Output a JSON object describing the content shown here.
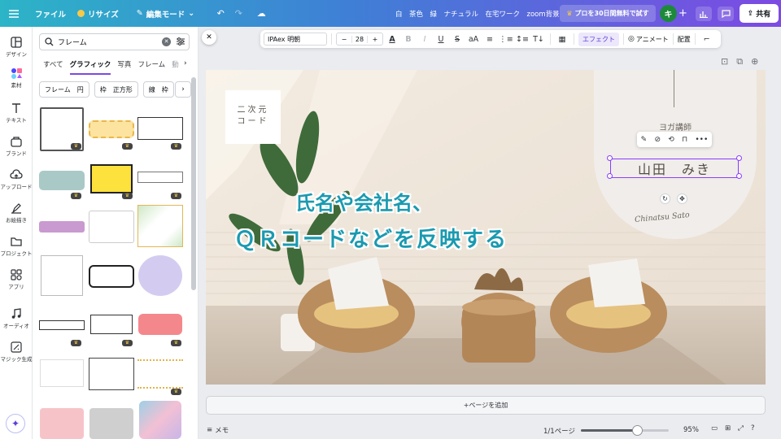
{
  "topbar": {
    "menu_icon": "hamburger-icon",
    "file": "ファイル",
    "resize": "リサイズ",
    "edit_mode": "編集モード",
    "doc_title": "白　茶色　緑　ナチュラル　在宅ワーク　zoom背景",
    "pro_trial": "プロを30日間無料で試す",
    "avatar_initial": "キ",
    "share": "共有"
  },
  "rail": {
    "items": [
      {
        "label": "デザイン",
        "icon": "layout-icon"
      },
      {
        "label": "素材",
        "icon": "elements-icon"
      },
      {
        "label": "テキスト",
        "icon": "text-icon"
      },
      {
        "label": "ブランド",
        "icon": "brand-icon"
      },
      {
        "label": "アップロード",
        "icon": "upload-cloud-icon"
      },
      {
        "label": "お絵描き",
        "icon": "draw-pen-icon"
      },
      {
        "label": "プロジェクト",
        "icon": "folder-icon"
      },
      {
        "label": "アプリ",
        "icon": "apps-grid-icon"
      },
      {
        "label": "オーディオ",
        "icon": "music-note-icon"
      },
      {
        "label": "マジック生成",
        "icon": "magic-generate-icon"
      }
    ]
  },
  "panel": {
    "search_value": "フレーム",
    "tabs": [
      "すべて",
      "グラフィック",
      "写真",
      "フレーム",
      "動"
    ],
    "active_tab": "グラフィック",
    "chips": [
      "フレーム　円",
      "枠　正方形",
      "線　枠"
    ]
  },
  "toolbar": {
    "font": "IPAex 明朝",
    "minus": "−",
    "size": "28",
    "plus": "+",
    "effect": "エフェクト",
    "animate": "アニメート",
    "position": "配置"
  },
  "canvas": {
    "qr_line1": "二次元",
    "qr_line2": "コード",
    "role": "ヨガ講師",
    "name": "山田　みき",
    "signature": "Chinatsu Sato",
    "overlay_line1": "氏名や会社名、",
    "overlay_line2": "ＱＲコードなどを反映する"
  },
  "add_page": "+ページを追加",
  "bottom": {
    "memo": "メモ",
    "pages": "1/1ページ",
    "zoom": "95%",
    "zoom_fraction": 0.64
  },
  "colors": {
    "accent": "#8b3dff",
    "overlay_text": "#1a9ab0",
    "avatar": "#1d8a3a"
  }
}
